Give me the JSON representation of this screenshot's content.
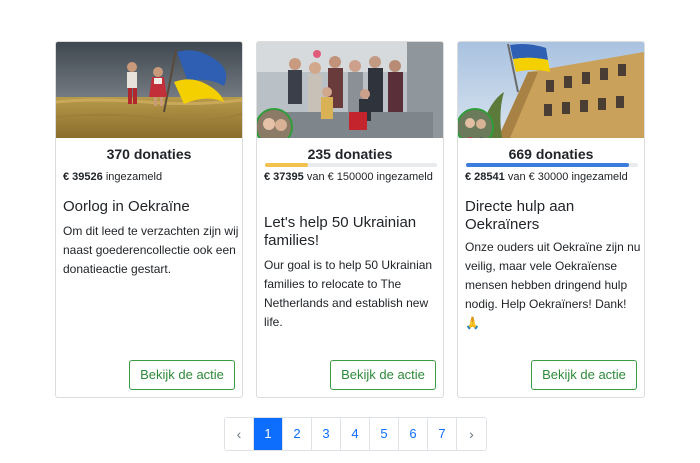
{
  "campaigns": [
    {
      "count": "370 donaties",
      "amount": "€ 39526",
      "raised_text": "ingezameld",
      "title": "Oorlog in Oekraïne",
      "description": "Om dit leed te verzachten zijn wij naast goederencollectie ook een donatieactie gestart.",
      "button": "Bekijk de actie"
    },
    {
      "count": "235 donaties",
      "amount": "€ 37395",
      "raised_text": "van € 150000 ingezameld",
      "progress": 0.25,
      "bar_color": "#f2c14e",
      "title": "Let's help 50 Ukrainian families!",
      "description": "Our goal is to help 50 Ukrainian families to relocate to The Netherlands and establish new life.",
      "button": "Bekijk de actie"
    },
    {
      "count": "669 donaties",
      "amount": "€ 28541",
      "raised_text": "van € 30000 ingezameld",
      "progress": 0.95,
      "bar_color": "#3b7ddd",
      "title": "Directe hulp aan Oekraïners",
      "description": "Onze ouders uit Oekraïne zijn nu veilig, maar vele Oekraïense mensen hebben dringend hulp nodig. Help Oekraïners! Dank! 🙏",
      "button": "Bekijk de actie"
    }
  ],
  "pagination": {
    "prev": "‹",
    "next": "›",
    "pages": [
      "1",
      "2",
      "3",
      "4",
      "5",
      "6",
      "7"
    ],
    "active": "1"
  },
  "colors": {
    "accent_green": "#2e8a3a",
    "primary_blue": "#0d6efd",
    "ukraine_blue": "#2f5fb3",
    "ukraine_yellow": "#f5d000"
  }
}
